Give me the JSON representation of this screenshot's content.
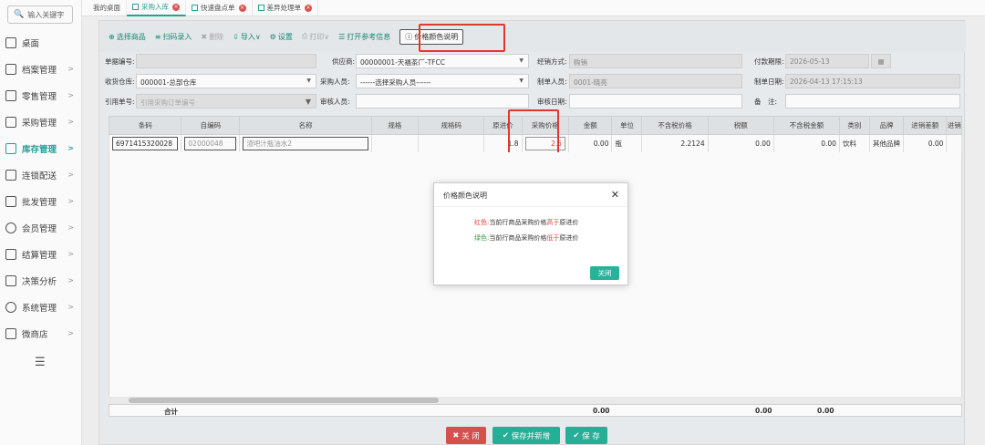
{
  "search": {
    "placeholder": "输入关键字"
  },
  "sidebar": {
    "items": [
      {
        "label": "桌面"
      },
      {
        "label": "档案管理"
      },
      {
        "label": "零售管理"
      },
      {
        "label": "采购管理"
      },
      {
        "label": "库存管理"
      },
      {
        "label": "连锁配送"
      },
      {
        "label": "批发管理"
      },
      {
        "label": "会员管理"
      },
      {
        "label": "结算管理"
      },
      {
        "label": "决策分析"
      },
      {
        "label": "系统管理"
      },
      {
        "label": "微商店"
      }
    ]
  },
  "tabs": [
    {
      "label": "我的桌面"
    },
    {
      "label": "采购入库"
    },
    {
      "label": "快速盘点单"
    },
    {
      "label": "差异处理单"
    }
  ],
  "toolbar": {
    "select_goods": "选择商品",
    "scan_entry": "扫码录入",
    "delete": "删除",
    "import": "导入",
    "settings": "设置",
    "print": "打印",
    "open_ref": "打开参考信息",
    "price_color": "价格颜色说明"
  },
  "form": {
    "doc_no_label": "单据编号:",
    "supplier_label": "供应商:",
    "supplier_value": "00000001-天福茶厂-TFCC",
    "biz_type_label": "经销方式:",
    "biz_type_value": "购销",
    "pay_term_label": "付款期限:",
    "pay_term_value": "2026-05-13",
    "warehouse_label": "收货仓库:",
    "warehouse_value": "000001-总部仓库",
    "buyer_label": "采购人员:",
    "buyer_value": "------选择采购人员------",
    "maker_label": "制单人员:",
    "maker_value": "0001-晓亮",
    "make_date_label": "制单日期:",
    "make_date_value": "2026-04-13 17:15:13",
    "ref_no_label": "引用单号:",
    "ref_no_placeholder": "引用采购订单编号",
    "auditor_label": "审核人员:",
    "audit_date_label": "审核日期:",
    "remark_label": "备　注:"
  },
  "grid": {
    "headers": [
      "条码",
      "自编码",
      "名称",
      "规格",
      "规格码",
      "原进价",
      "采购价格",
      "金额",
      "单位",
      "不含税价格",
      "税额",
      "不含税金额",
      "类别",
      "品牌",
      "进销差额",
      "进销"
    ],
    "row": {
      "barcode": "6971415320028",
      "code": "02000048",
      "name": "渣吧汁瓶油水2",
      "orig_price": "1.8",
      "buy_price": "2.5",
      "amount": "0.00",
      "unit": "瓶",
      "ex_tax_price": "2.2124",
      "tax": "0.00",
      "ex_tax_amount": "0.00",
      "category": "饮料",
      "brand": "其他品牌",
      "diff": "0.00"
    },
    "footer": {
      "label": "合计",
      "amount": "0.00",
      "tax": "0.00",
      "ex_tax_amount": "0.00"
    }
  },
  "buttons": {
    "close": "关 闭",
    "save_new": "保存并新增",
    "save": "保 存"
  },
  "modal": {
    "title": "价格颜色说明",
    "red_label": "红色:",
    "red_text_a": "当前行商品采购价格",
    "red_text_b": "高于",
    "red_text_c": "原进价",
    "green_label": "绿色:",
    "green_text_a": "当前行商品采购价格",
    "green_text_b": "低于",
    "green_text_c": "原进价",
    "close": "关闭"
  },
  "colors": {
    "accent": "#26a69a",
    "red": "#e53935",
    "green": "#2e9e3e"
  }
}
